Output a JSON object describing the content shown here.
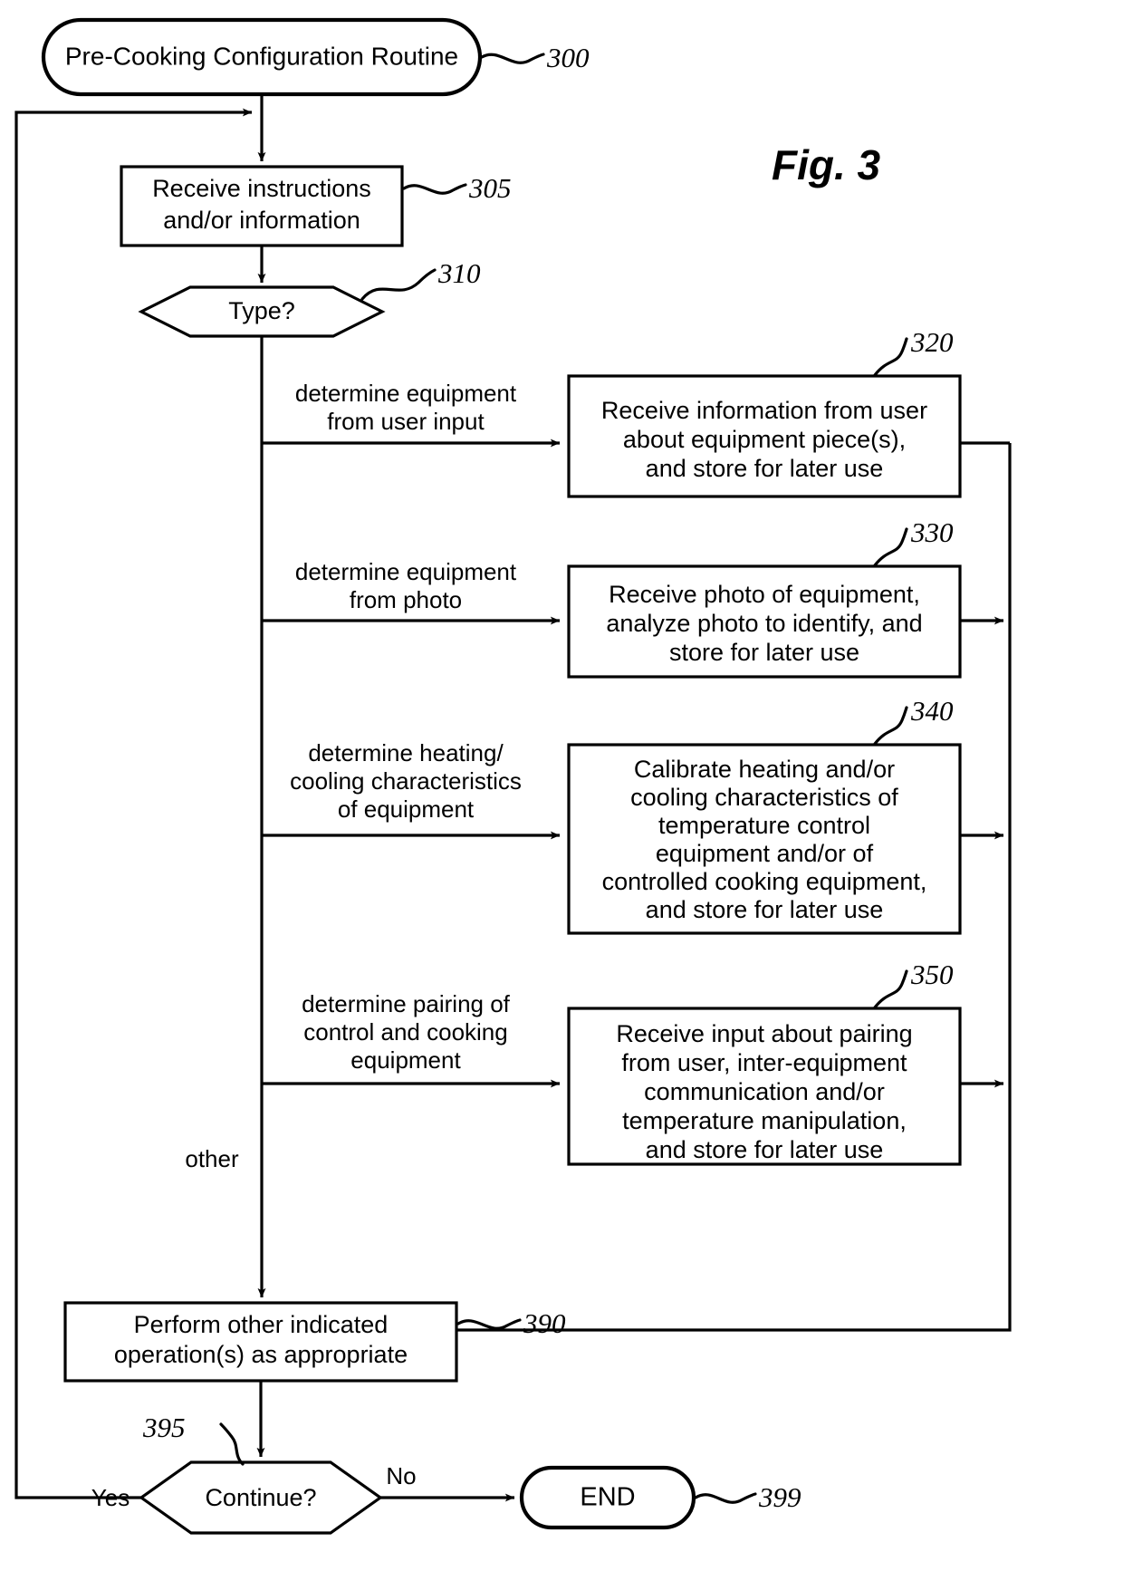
{
  "figure": {
    "label": "Fig. 3",
    "title": "Pre-Cooking Configuration Routine flowchart"
  },
  "nodes": {
    "start": {
      "id": "300",
      "label": "Pre-Cooking Configuration Routine",
      "shape": "rounded-terminator"
    },
    "receive": {
      "id": "305",
      "lines": [
        "Receive instructions",
        "and/or information"
      ],
      "shape": "process"
    },
    "type_decision": {
      "id": "310",
      "label": "Type?",
      "shape": "hexagon-decision"
    },
    "box320": {
      "id": "320",
      "lines": [
        "Receive information from user",
        "about equipment piece(s),",
        "and store for later use"
      ],
      "shape": "process"
    },
    "box330": {
      "id": "330",
      "lines": [
        "Receive photo of equipment,",
        "analyze photo to identify, and",
        "store for later use"
      ],
      "shape": "process"
    },
    "box340": {
      "id": "340",
      "lines": [
        "Calibrate heating and/or",
        "cooling characteristics of",
        "temperature control",
        "equipment and/or of",
        "controlled cooking equipment,",
        "and store for later use"
      ],
      "shape": "process"
    },
    "box350": {
      "id": "350",
      "lines": [
        "Receive input about pairing",
        "from user, inter-equipment",
        "communication and/or",
        "temperature manipulation,",
        "and store for later use"
      ],
      "shape": "process"
    },
    "box390": {
      "id": "390",
      "lines": [
        "Perform other indicated",
        "operation(s) as appropriate"
      ],
      "shape": "process"
    },
    "continue_decision": {
      "id": "395",
      "label": "Continue?",
      "shape": "hexagon-decision"
    },
    "end": {
      "id": "399",
      "label": "END",
      "shape": "rounded-terminator"
    }
  },
  "branch_labels": {
    "b320": [
      "determine equipment",
      "from user input"
    ],
    "b330": [
      "determine equipment",
      "from photo"
    ],
    "b340": [
      "determine heating/",
      "cooling characteristics",
      "of equipment"
    ],
    "b350": [
      "determine pairing of",
      "control and cooking",
      "equipment"
    ],
    "other": "other",
    "yes": "Yes",
    "no": "No"
  },
  "colors": {
    "stroke": "#000000",
    "fill": "#ffffff",
    "background": "#ffffff"
  }
}
